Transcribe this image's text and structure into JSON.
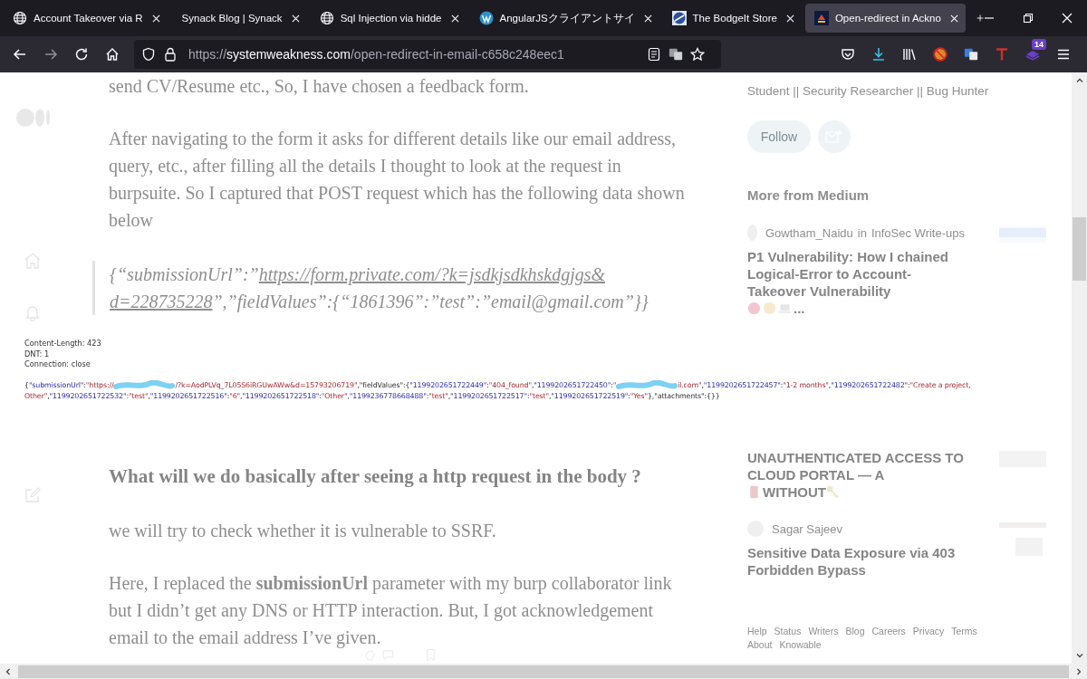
{
  "tabs": [
    {
      "title": "Account Takeover via R",
      "selected": false
    },
    {
      "title": "Synack Blog | Synack",
      "selected": false
    },
    {
      "title": "Sql Injection via hidde",
      "selected": false
    },
    {
      "title": "AngularJSクライアントサイ",
      "selected": false
    },
    {
      "title": "The BodgeIt Store",
      "selected": false
    },
    {
      "title": "Open-redirect in Ackno",
      "selected": true
    }
  ],
  "toolbar": {
    "url": {
      "scheme": "https://",
      "host": "systemweakness.com",
      "path": "/open-redirect-in-email-c658c248eec1"
    },
    "extension_badge": "14"
  },
  "article": {
    "paragraphs_top": [
      "send CV/Resume etc., So, I have chosen a feedback form.",
      "After navigating to the form it asks for different details like our email address, query, etc., after filling all the details I thought to look at the request in burpsuite. So I captured that POST request which has the following data shown below"
    ],
    "quote": [
      {
        "before": "{“submissionUrl”:”",
        "link": "https://form.private.com/?k=jsdkjsdkhskdgjgs&"
      },
      {
        "link": "d=228735228",
        "after": "”,”fieldValues”:{“1861396”:”test”:”email@gmail.com”}}"
      }
    ],
    "heading": "What will we do basically after seeing a http request in the body ?",
    "paragraphs_bottom": [
      "we will try to check whether it is vulnerable to SSRF.",
      "Here, I replaced the **submissionUrl** parameter with my burp collaborator link but I didn’t get any DNS or HTTP interaction. But, I got acknowledgement email to the email address I’ve given."
    ]
  },
  "request_image": {
    "headers": [
      "Content-Length: 423",
      "DNT: 1",
      "Connection: close"
    ],
    "body_lines": [
      [
        {
          "kind": "code",
          "tokens": [
            {
              "kind": "punct",
              "text": "{"
            },
            {
              "kind": "key",
              "text": "\"submissionUrl\""
            },
            {
              "kind": "punct",
              "text": ":"
            },
            {
              "kind": "value",
              "text": "\"https://"
            }
          ]
        },
        {
          "kind": "redacted"
        },
        {
          "kind": "code",
          "tokens": [
            {
              "kind": "value",
              "text": "/?k=AodPLVq_7L05S6iRGUwAWw&d=15793206719\""
            },
            {
              "kind": "punct",
              "text": ",\"fieldValues\":{"
            },
            {
              "kind": "key",
              "text": "\"1199202651722449\""
            },
            {
              "kind": "punct",
              "text": ":"
            },
            {
              "kind": "value",
              "text": "\"404_found\""
            },
            {
              "kind": "punct",
              "text": ","
            },
            {
              "kind": "key",
              "text": "\"1199202651722450\""
            },
            {
              "kind": "punct",
              "text": ":"
            },
            {
              "kind": "value",
              "text": "\""
            }
          ]
        },
        {
          "kind": "redacted"
        },
        {
          "kind": "code",
          "tokens": [
            {
              "kind": "value",
              "text": "il.com\""
            },
            {
              "kind": "punct",
              "text": ","
            },
            {
              "kind": "key",
              "text": "\"1199202651722457\""
            },
            {
              "kind": "punct",
              "text": ":"
            },
            {
              "kind": "value",
              "text": "\"1-2 months\""
            },
            {
              "kind": "punct",
              "text": ","
            },
            {
              "kind": "key",
              "text": "\"1199202651722482\""
            },
            {
              "kind": "punct",
              "text": ":"
            },
            {
              "kind": "value",
              "text": "\"Create a project,"
            }
          ]
        }
      ],
      [
        {
          "kind": "code",
          "tokens": [
            {
              "kind": "value",
              "text": "Other\""
            },
            {
              "kind": "punct",
              "text": ","
            },
            {
              "kind": "key",
              "text": "\"1199202651722532\""
            },
            {
              "kind": "punct",
              "text": ":"
            },
            {
              "kind": "value",
              "text": "\"test\""
            },
            {
              "kind": "punct",
              "text": ","
            },
            {
              "kind": "key",
              "text": "\"1199202651722516\""
            },
            {
              "kind": "punct",
              "text": ":"
            },
            {
              "kind": "value",
              "text": "\"6\""
            },
            {
              "kind": "punct",
              "text": ","
            },
            {
              "kind": "key",
              "text": "\"1199202651722518\""
            },
            {
              "kind": "punct",
              "text": ":"
            },
            {
              "kind": "value",
              "text": "\"Other\""
            },
            {
              "kind": "punct",
              "text": ","
            },
            {
              "kind": "key",
              "text": "\"1199236778668488\""
            },
            {
              "kind": "punct",
              "text": ":"
            },
            {
              "kind": "value",
              "text": "\"test\""
            },
            {
              "kind": "punct",
              "text": ","
            },
            {
              "kind": "key",
              "text": "\"1199202651722517\""
            },
            {
              "kind": "punct",
              "text": ":"
            },
            {
              "kind": "value",
              "text": "\"test\""
            },
            {
              "kind": "punct",
              "text": ","
            },
            {
              "kind": "key",
              "text": "\"1199202651722519\""
            },
            {
              "kind": "punct",
              "text": ":"
            },
            {
              "kind": "value",
              "text": "\"Yes\""
            },
            {
              "kind": "punct",
              "text": "},\"attachments\":{}}"
            }
          ]
        }
      ]
    ]
  },
  "sidebar": {
    "bio": "Student || Security Researcher || Bug Hunter",
    "follow_button": "Follow",
    "section_title": "More from Medium",
    "stories": [
      {
        "author": "Gowtham_Naidu",
        "in_word": "in",
        "publication": "InfoSec Write-ups",
        "title_parts": [
          "P1 Vulnerability: How I chained Logical-Error to Account-Takeover Vulnerability",
          "..."
        ]
      },
      {
        "title_parts": [
          "UNAUTHENTICATED ACCESS TO CLOUD PORTAL — A",
          "WITHOUT"
        ]
      },
      {
        "author": "Sagar Sajeev",
        "title_parts": [
          "Sensitive Data Exposure via 403 Forbidden Bypass"
        ]
      }
    ],
    "footer_links": [
      "Help",
      "Status",
      "Writers",
      "Blog",
      "Careers",
      "Privacy",
      "Terms",
      "About",
      "Knowable"
    ]
  }
}
